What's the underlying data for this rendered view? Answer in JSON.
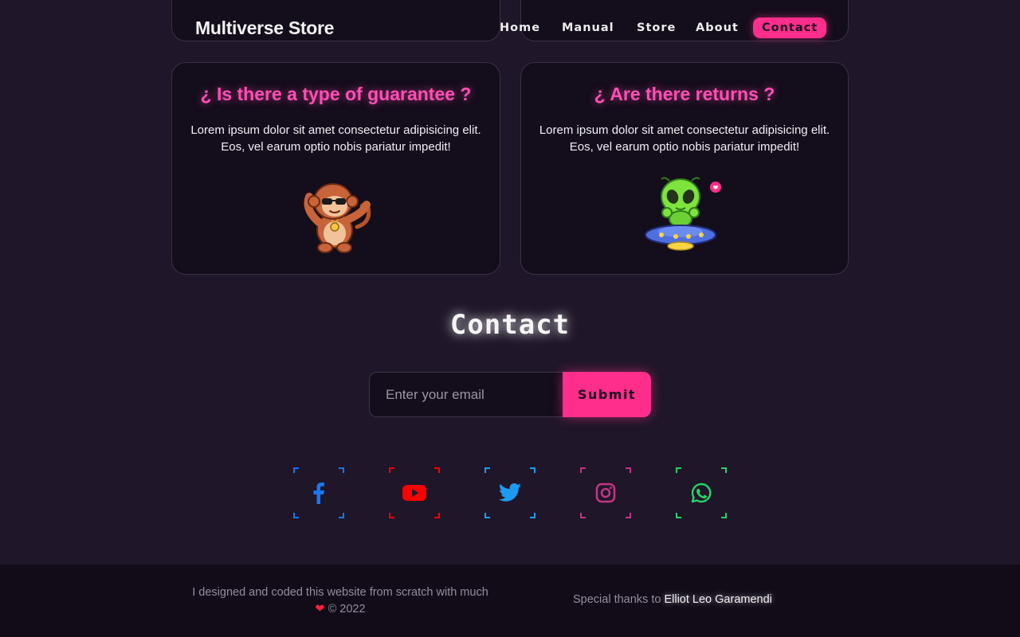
{
  "header": {
    "brand": "Multiverse Store",
    "nav": [
      {
        "label": "Home"
      },
      {
        "label": "Manual"
      },
      {
        "label": "Store"
      },
      {
        "label": "About"
      },
      {
        "label": "Contact"
      }
    ]
  },
  "faq": [
    {
      "title": "¿ Is there a type of guarantee ?",
      "text": "Lorem ipsum dolor sit amet consectetur adipisicing elit. Eos, vel earum optio nobis pariatur impedit!",
      "image": "monkey-dabbing"
    },
    {
      "title": "¿ Are there returns ?",
      "text": "Lorem ipsum dolor sit amet consectetur adipisicing elit. Eos, vel earum optio nobis pariatur impedit!",
      "image": "alien-ufo"
    }
  ],
  "contact": {
    "title": "Contact",
    "email_placeholder": "Enter your email",
    "email_value": "",
    "submit_label": "Submit"
  },
  "social": [
    {
      "name": "facebook-icon",
      "color": "#1877f2"
    },
    {
      "name": "youtube-icon",
      "color": "#ff0000"
    },
    {
      "name": "twitter-icon",
      "color": "#1d9bf0"
    },
    {
      "name": "instagram-icon",
      "color": "#c13584"
    },
    {
      "name": "whatsapp-icon",
      "color": "#25d366"
    }
  ],
  "footer": {
    "left_text": "I designed and coded this website from scratch with much",
    "heart": "❤",
    "copyright": "© 2022",
    "thanks_prefix": "Special thanks to",
    "thanks_name": "Elliot Leo Garamendi"
  },
  "colors": {
    "accent": "#ff2d8c",
    "title_pink": "#ff4fb4",
    "background": "#1f1629",
    "card": "#140d1b"
  }
}
